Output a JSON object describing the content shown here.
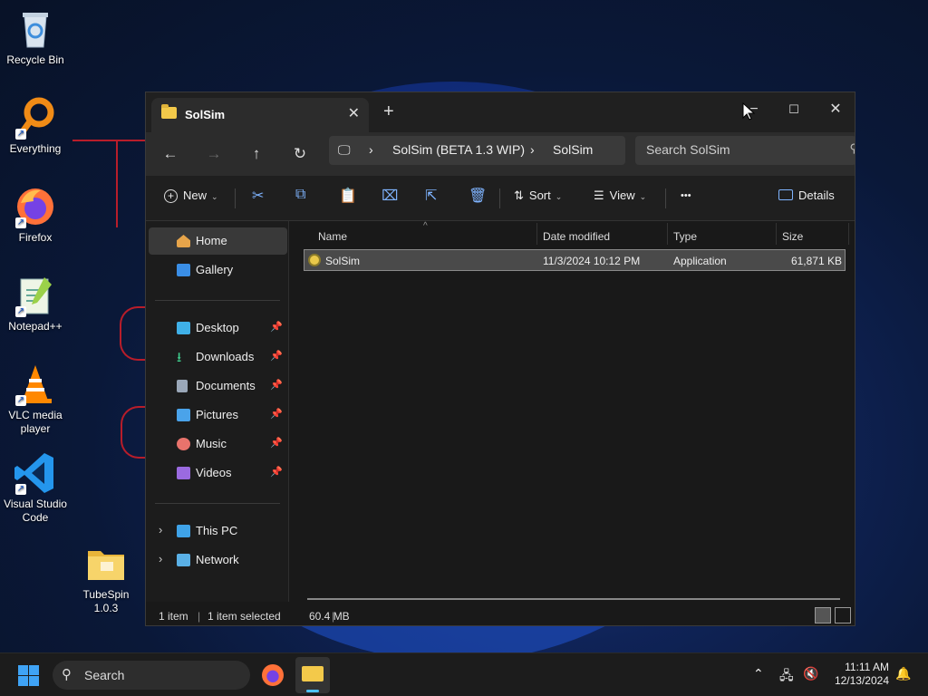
{
  "desktop": {
    "icons": [
      {
        "label": "Recycle Bin"
      },
      {
        "label": "Everything"
      },
      {
        "label": "Firefox"
      },
      {
        "label": "Notepad++"
      },
      {
        "label": "VLC media player"
      },
      {
        "label": "Visual Studio Code"
      },
      {
        "label": "TubeSpin 1.0.3"
      }
    ]
  },
  "window": {
    "tab_title": "SolSim",
    "tab_close": "✕",
    "new_tab": "+",
    "min_icon": "−",
    "max_icon": "☐",
    "close_icon": "✕"
  },
  "address": {
    "crumbs": [
      "SolSim (BETA 1.3 WIP)",
      "SolSim"
    ],
    "search_placeholder": "Search SolSim"
  },
  "commands": {
    "new": "New",
    "sort": "Sort",
    "view": "View",
    "more": "•••",
    "details": "Details"
  },
  "nav": {
    "home": "Home",
    "gallery": "Gallery",
    "desktop": "Desktop",
    "downloads": "Downloads",
    "documents": "Documents",
    "pictures": "Pictures",
    "music": "Music",
    "videos": "Videos",
    "this_pc": "This PC",
    "network": "Network"
  },
  "columns": {
    "name": "Name",
    "date_modified": "Date modified",
    "type": "Type",
    "size": "Size"
  },
  "files": [
    {
      "name": "SolSim",
      "date_modified": "11/3/2024 10:12 PM",
      "type": "Application",
      "size": "61,871 KB"
    }
  ],
  "status": {
    "count": "1 item",
    "selection": "1 item selected",
    "sel_size": "60.4 MB"
  },
  "taskbar": {
    "search_placeholder": "Search",
    "time": "11:11 AM",
    "date": "12/13/2024"
  },
  "colors": {
    "accent": "#4cc2ff",
    "folder": "#f3c94a",
    "window_bg": "#191919"
  }
}
